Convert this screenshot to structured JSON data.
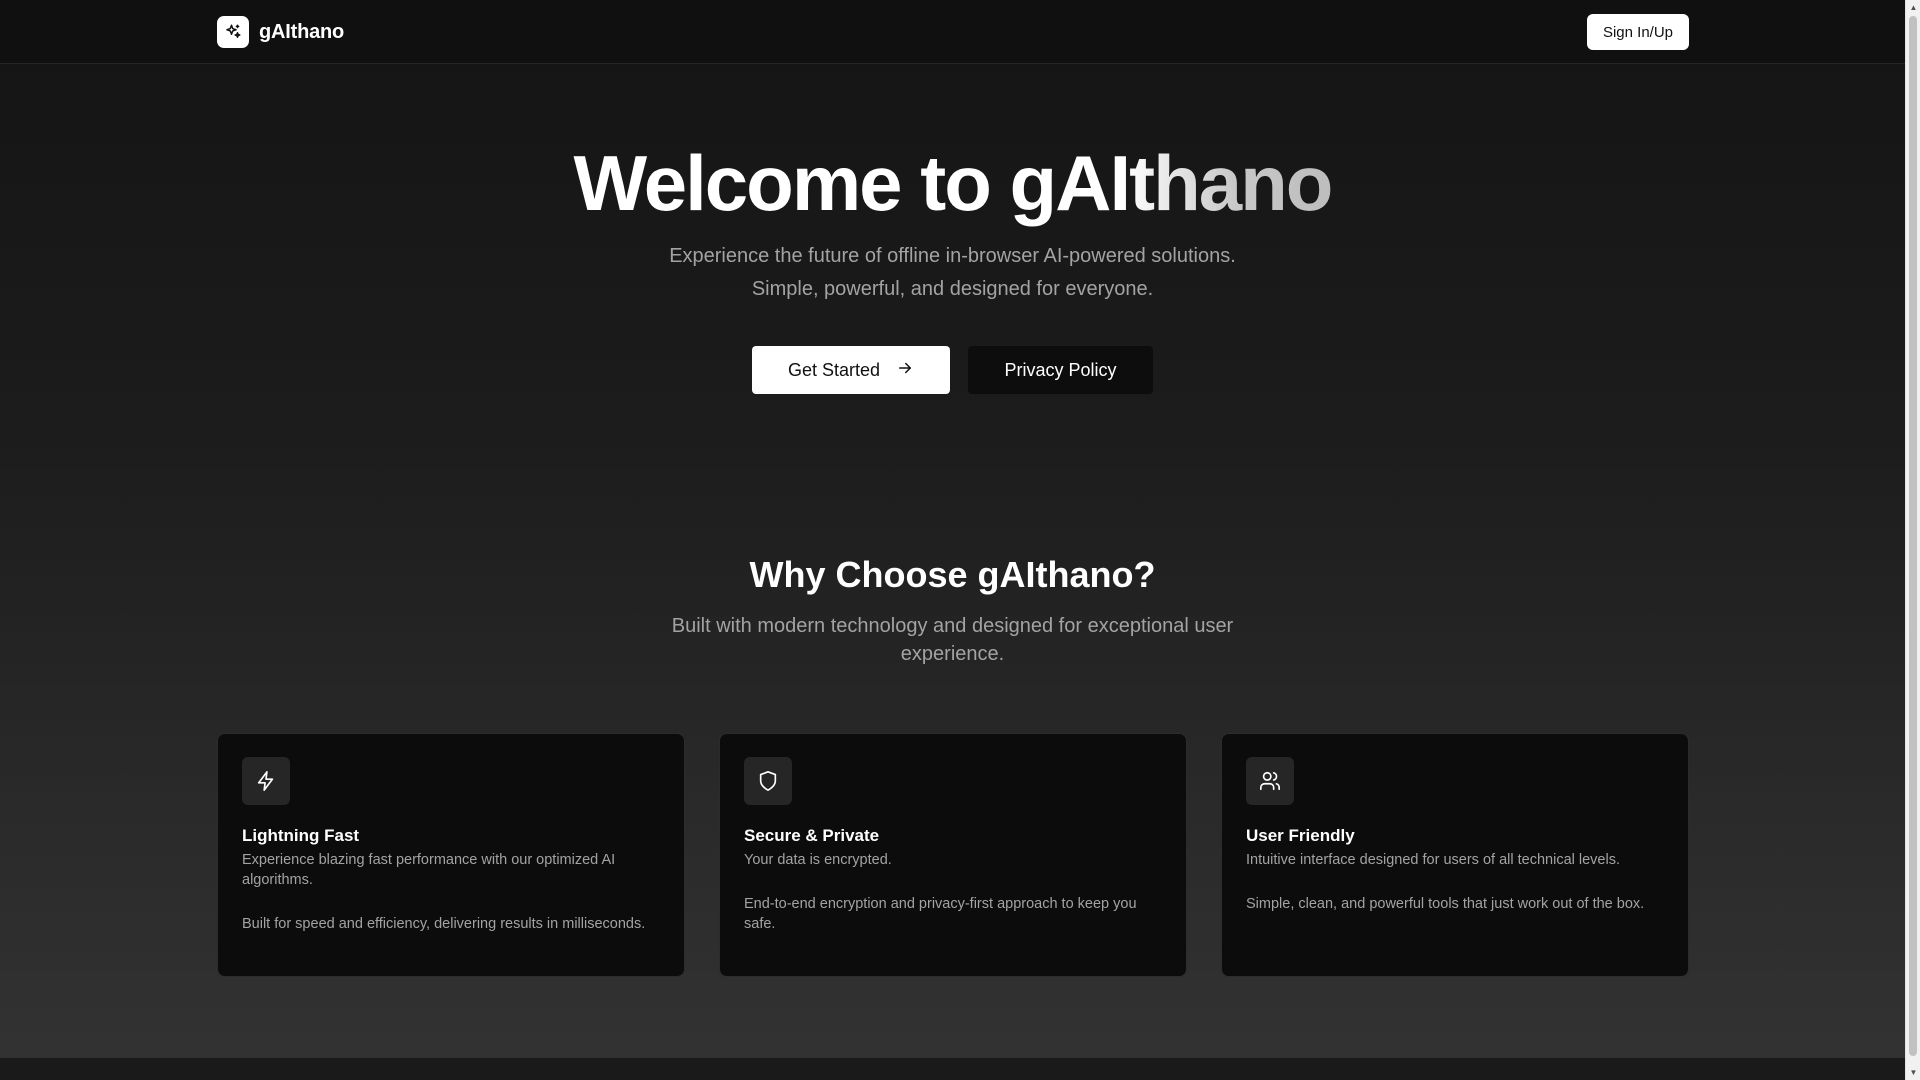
{
  "header": {
    "brand_name": "gAIthano",
    "logo_icon": "sparkles-icon",
    "signin_label": "Sign In/Up"
  },
  "hero": {
    "title_prefix": "Welcome to ",
    "title_name": "gAIthano",
    "subtitle_line1": "Experience the future of offline in-browser AI-powered solutions.",
    "subtitle_line2": "Simple, powerful, and designed for everyone.",
    "primary_label": "Get Started",
    "primary_icon": "arrow-right-icon",
    "secondary_label": "Privacy Policy"
  },
  "why": {
    "title": "Why Choose gAIthano?",
    "subtitle_line1": "Built with modern technology and designed for exceptional user",
    "subtitle_line2": "experience."
  },
  "features": [
    {
      "icon": "lightning-icon",
      "title": "Lightning Fast",
      "description": "Experience blazing fast performance with our optimized AI algorithms.",
      "detail": "Built for speed and efficiency, delivering results in milliseconds."
    },
    {
      "icon": "shield-icon",
      "title": "Secure & Private",
      "description": "Your data is encrypted.",
      "detail": "End-to-end encryption and privacy-first approach to keep you safe."
    },
    {
      "icon": "users-icon",
      "title": "User Friendly",
      "description": "Intuitive interface designed for users of all technical levels.",
      "detail": "Simple, clean, and powerful tools that just work out of the box."
    }
  ],
  "colors": {
    "background": "#1a1a1a",
    "header": "#101010",
    "card": "#0c0c0c",
    "muted_text": "#a3a3a3",
    "primary_button": "#ffffff"
  }
}
